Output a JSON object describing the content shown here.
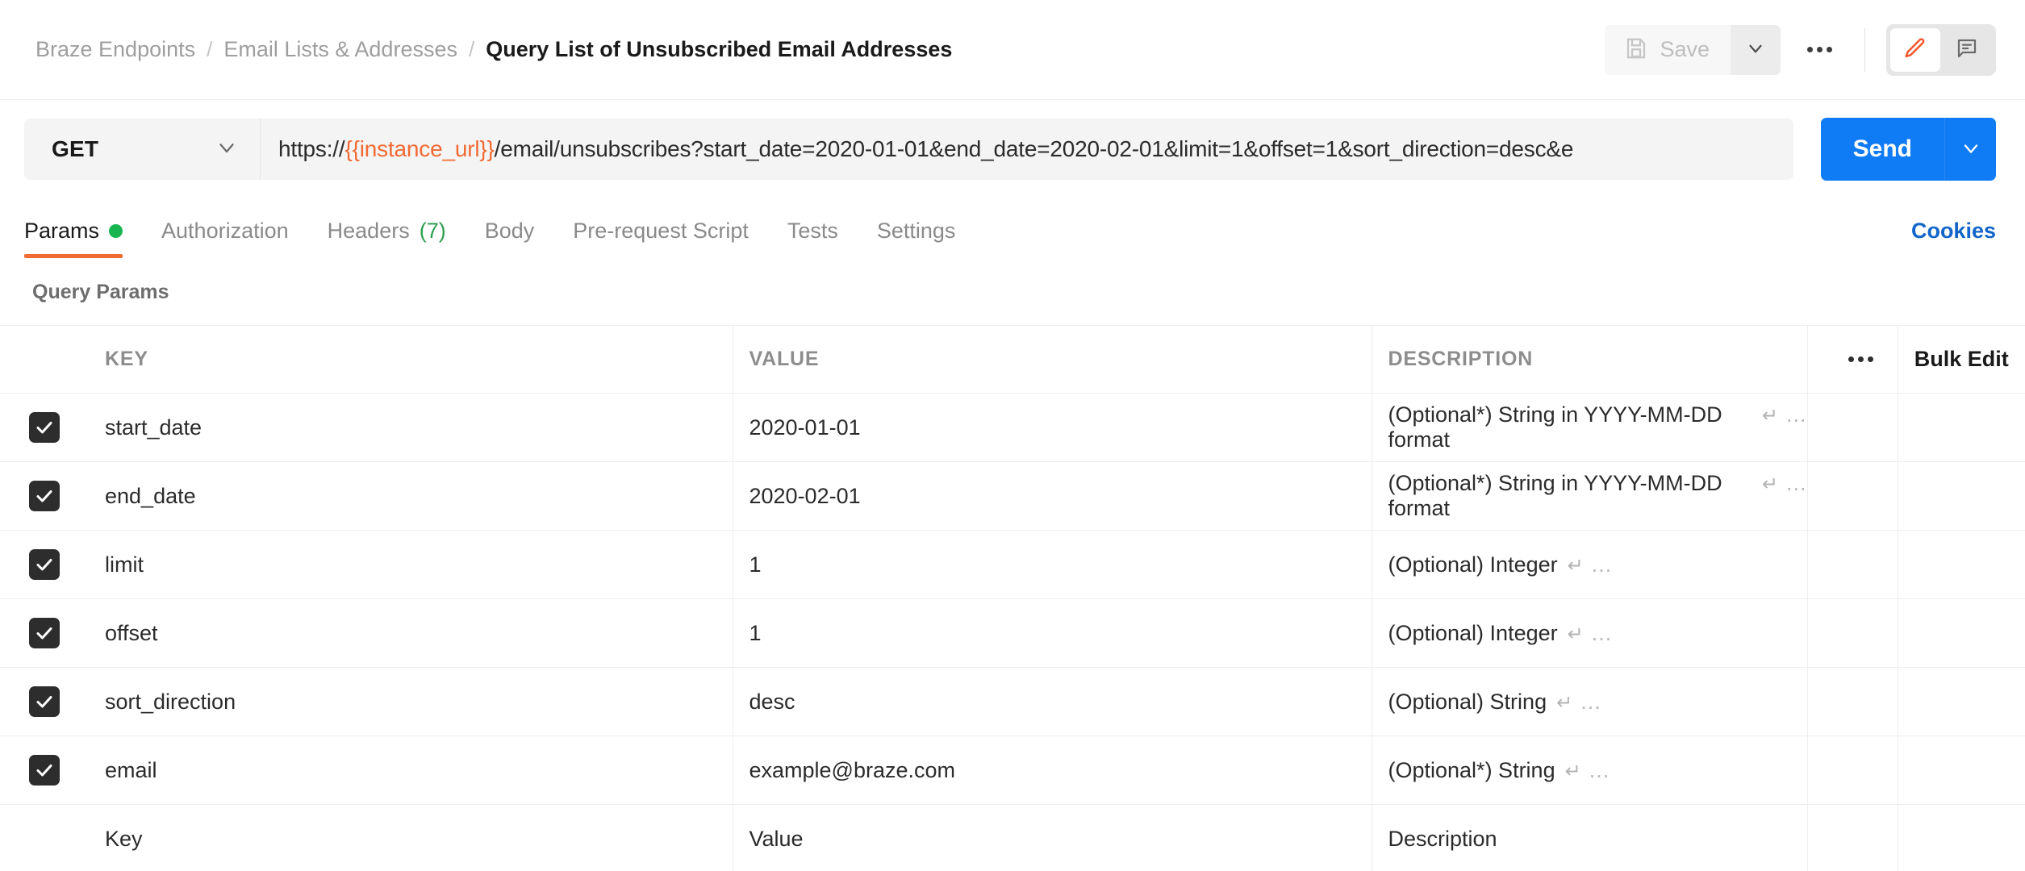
{
  "breadcrumb": {
    "items": [
      {
        "label": "Braze Endpoints",
        "current": false
      },
      {
        "label": "Email Lists & Addresses",
        "current": false
      },
      {
        "label": "Query List of Unsubscribed Email Addresses",
        "current": true
      }
    ],
    "separator": "/"
  },
  "header": {
    "save_label": "Save",
    "save_icon": "floppy-disk-icon",
    "save_caret_icon": "chevron-down-icon",
    "more_icon": "ellipsis-icon",
    "edit_icon": "pencil-icon",
    "comment_icon": "comment-icon",
    "edit_active": true,
    "accent_orange": "#f26a33"
  },
  "request": {
    "method": "GET",
    "method_caret_icon": "chevron-down-icon",
    "url_prefix": "https://",
    "url_variable": "{{instance_url}}",
    "url_suffix": "/email/unsubscribes?start_date=2020-01-01&end_date=2020-02-01&limit=1&offset=1&sort_direction=desc&e",
    "send_label": "Send",
    "send_caret_icon": "chevron-down-icon",
    "send_color": "#0f7bf5"
  },
  "tabs": [
    {
      "label": "Params",
      "active": true,
      "dot": true,
      "count": null
    },
    {
      "label": "Authorization",
      "active": false,
      "dot": false,
      "count": null
    },
    {
      "label": "Headers",
      "active": false,
      "dot": false,
      "count": "(7)"
    },
    {
      "label": "Body",
      "active": false,
      "dot": false,
      "count": null
    },
    {
      "label": "Pre-request Script",
      "active": false,
      "dot": false,
      "count": null
    },
    {
      "label": "Tests",
      "active": false,
      "dot": false,
      "count": null
    },
    {
      "label": "Settings",
      "active": false,
      "dot": false,
      "count": null
    }
  ],
  "cookies_label": "Cookies",
  "params": {
    "section_title": "Query Params",
    "columns": {
      "key": "KEY",
      "value": "VALUE",
      "description": "DESCRIPTION",
      "bulk_edit": "Bulk Edit",
      "options_icon": "ellipsis-icon"
    },
    "rows": [
      {
        "checked": true,
        "key": "start_date",
        "value": "2020-01-01",
        "description": "(Optional*) String in YYYY-MM-DD format",
        "ret": "↵",
        "ellipsis": "..."
      },
      {
        "checked": true,
        "key": "end_date",
        "value": "2020-02-01",
        "description": "(Optional*)  String in YYYY-MM-DD format",
        "ret": "↵",
        "ellipsis": "..."
      },
      {
        "checked": true,
        "key": "limit",
        "value": "1",
        "description": "(Optional) Integer",
        "ret": "↵",
        "ellipsis": "..."
      },
      {
        "checked": true,
        "key": "offset",
        "value": "1",
        "description": "(Optional) Integer ",
        "ret": "↵",
        "ellipsis": "..."
      },
      {
        "checked": true,
        "key": "sort_direction",
        "value": "desc",
        "description": "(Optional) String",
        "ret": "↵",
        "ellipsis": "..."
      },
      {
        "checked": true,
        "key": "email",
        "value": "example@braze.com",
        "description": "(Optional*) String",
        "ret": "↵",
        "ellipsis": "..."
      }
    ],
    "new_row_placeholders": {
      "key": "Key",
      "value": "Value",
      "description": "Description"
    }
  }
}
